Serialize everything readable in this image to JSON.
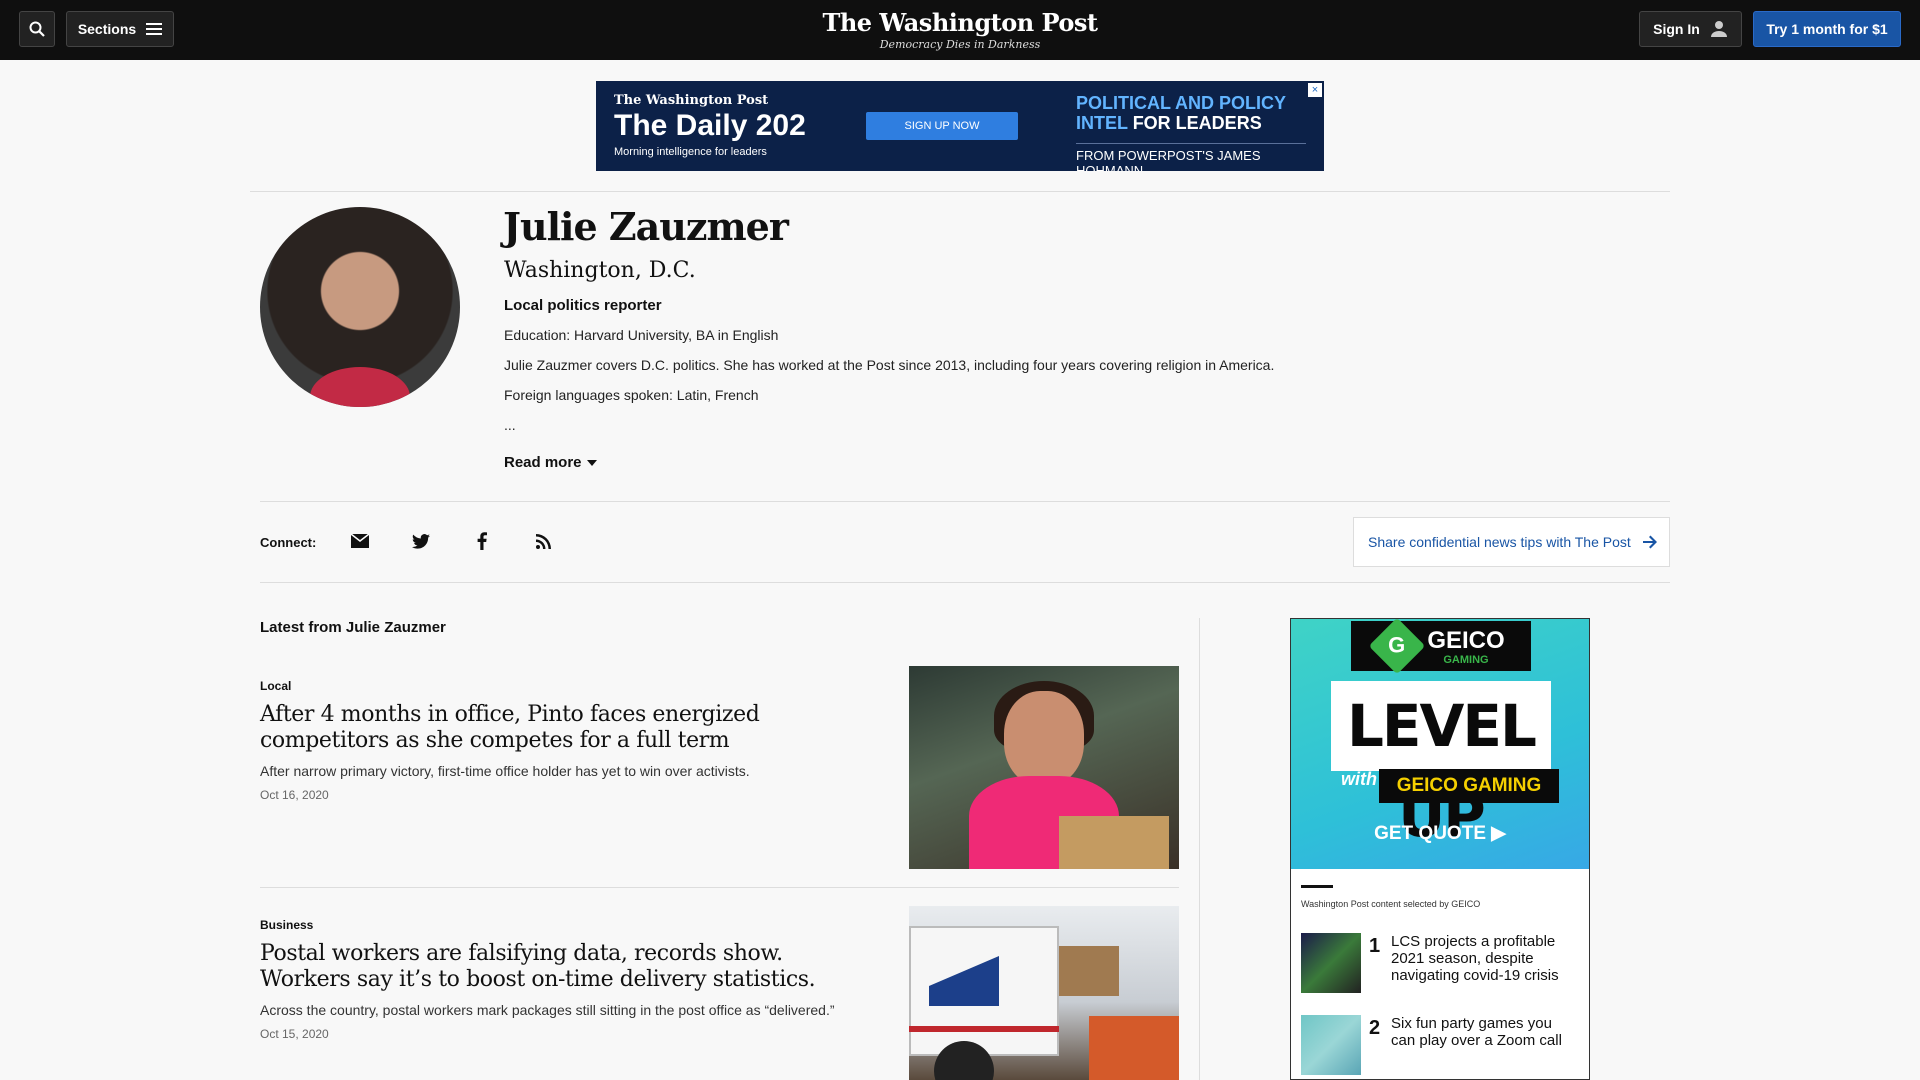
{
  "topbar": {
    "sections_label": "Sections",
    "logo_name": "The Washington Post",
    "logo_tagline": "Democracy Dies in Darkness",
    "signin_label": "Sign In",
    "try_label": "Try 1 month for $1"
  },
  "banner_ad": {
    "brand": "The Washington Post",
    "title": "The Daily 202",
    "subtitle": "Morning intelligence for leaders",
    "cta": "SIGN UP NOW",
    "headline_a": "POLITICAL AND POLICY",
    "headline_b1": "INTEL",
    "headline_b2": "FOR LEADERS",
    "byline": "FROM POWERPOST'S JAMES HOHMANN",
    "close": "×"
  },
  "profile": {
    "name": "Julie Zauzmer",
    "location": "Washington, D.C.",
    "role": "Local politics reporter",
    "education": "Education: Harvard University, BA in English",
    "bio": "Julie Zauzmer covers D.C. politics. She has worked at the Post since 2013, including four years covering religion in America.",
    "languages": "Foreign languages spoken: Latin, French",
    "ellipsis": "...",
    "read_more": "Read more"
  },
  "connect": {
    "label": "Connect:",
    "icons": [
      "email-icon",
      "twitter-icon",
      "facebook-icon",
      "rss-icon"
    ],
    "tips_label": "Share confidential news tips with The Post"
  },
  "latest": {
    "title": "Latest from Julie Zauzmer",
    "stories": [
      {
        "kicker": "Local",
        "headline": "After 4 months in office, Pinto faces energized competitors as she competes for a full term",
        "blurb": "After narrow primary victory, first-time office holder has yet to win over activists.",
        "date": "Oct 16, 2020"
      },
      {
        "kicker": "Business",
        "headline": "Postal workers are falsifying data, records show. Workers say it’s to boost on-time delivery statistics.",
        "blurb": "Across the country, postal workers mark packages still sitting in the post office as “delivered.”",
        "date": "Oct 15, 2020"
      }
    ]
  },
  "side_ad": {
    "brand": "GEICO",
    "brand_sub": "GAMING",
    "headline": "LEVEL UP",
    "with": "with",
    "gg": "GEICO GAMING",
    "cta": "GET QUOTE ▶",
    "selected_by": "Washington Post content selected by GEICO",
    "items": [
      {
        "num": "1",
        "text": "LCS projects a profitable 2021 season, despite navigating covid-19 crisis"
      },
      {
        "num": "2",
        "text": "Six fun party games you can play over a Zoom call"
      }
    ]
  }
}
